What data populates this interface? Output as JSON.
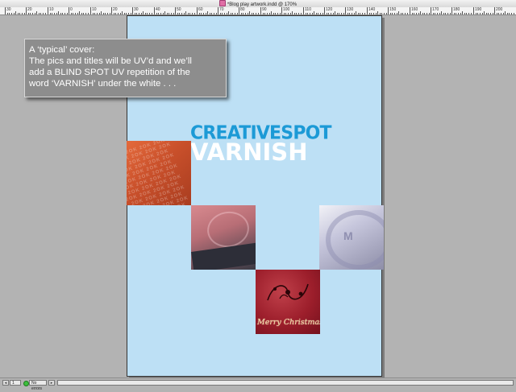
{
  "window": {
    "title": "*Blog play artwork.indd @ 170%"
  },
  "ruler": {
    "labels": [
      "30",
      "20",
      "10",
      "0",
      "10",
      "20",
      "30",
      "40",
      "50",
      "60",
      "70",
      "80",
      "90",
      "100",
      "110",
      "120",
      "130",
      "140",
      "150",
      "160",
      "170",
      "180",
      "190",
      "200",
      "210"
    ]
  },
  "callout": {
    "lines": [
      "A ‘typical’ cover:",
      "The pics and titles will be UV’d and we’ll",
      "add a BLIND SPOT UV repetition of the",
      "word ‘VARNISH’ under the white . . ."
    ]
  },
  "cover": {
    "brand_top": "CREATIVESPOT",
    "brand_bottom": "VARNISH",
    "xmas_text": "Merry Christmas",
    "photo_pattern_text": "2OK 2OK 2OK 2OK"
  },
  "statusbar": {
    "page_number": "1",
    "errors": "No errors"
  },
  "colors": {
    "page": "#bde0f5",
    "brand_blue": "#1c9ad6",
    "pasteboard": "#b3b3b3",
    "callout_bg": "#8d8d8d"
  }
}
